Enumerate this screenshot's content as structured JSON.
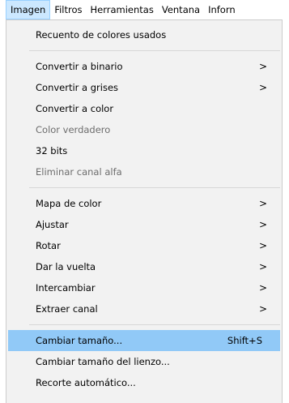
{
  "menubar": {
    "items": [
      {
        "label": "Imagen"
      },
      {
        "label": "Filtros"
      },
      {
        "label": "Herramientas"
      },
      {
        "label": "Ventana"
      },
      {
        "label": "Inforn"
      }
    ]
  },
  "menu": {
    "items": [
      {
        "label": "Recuento de colores usados"
      },
      {
        "label": "Convertir a binario",
        "submenu": ">"
      },
      {
        "label": "Convertir a grises",
        "submenu": ">"
      },
      {
        "label": "Convertir a color"
      },
      {
        "label": "Color verdadero"
      },
      {
        "label": "32 bits"
      },
      {
        "label": "Eliminar canal alfa"
      },
      {
        "label": "Mapa de color",
        "submenu": ">"
      },
      {
        "label": "Ajustar",
        "submenu": ">"
      },
      {
        "label": "Rotar",
        "submenu": ">"
      },
      {
        "label": "Dar la vuelta",
        "submenu": ">"
      },
      {
        "label": "Intercambiar",
        "submenu": ">"
      },
      {
        "label": "Extraer canal",
        "submenu": ">"
      },
      {
        "label": "Cambiar tamaño...",
        "shortcut": "Shift+S"
      },
      {
        "label": "Cambiar tamaño del lienzo..."
      },
      {
        "label": "Recorte automático..."
      }
    ]
  }
}
